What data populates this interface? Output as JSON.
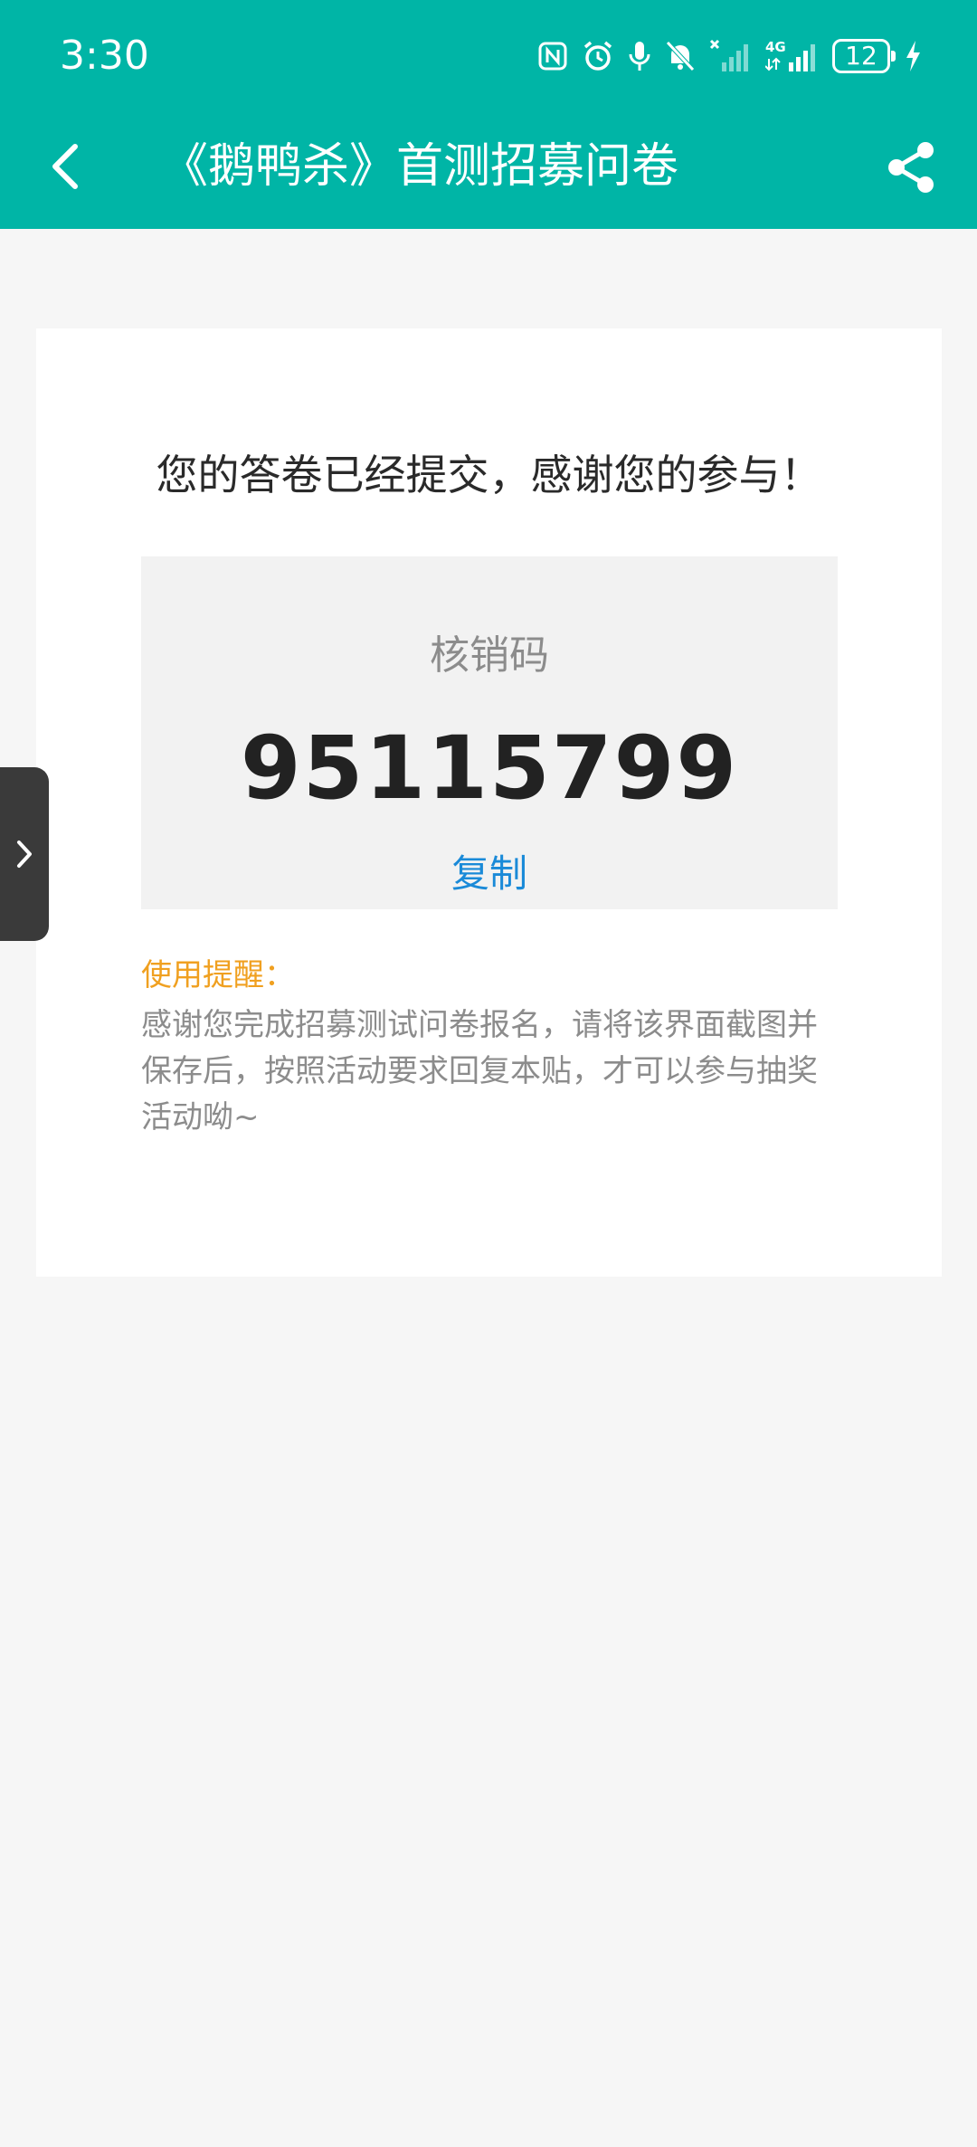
{
  "status_bar": {
    "time": "3:30",
    "battery_level": "12",
    "icons": [
      "nfc-icon",
      "alarm-icon",
      "mic-icon",
      "mute-bell-icon",
      "no-signal-icon",
      "4g-signal-icon",
      "battery-icon",
      "charging-icon"
    ]
  },
  "header": {
    "title": "《鹅鸭杀》首测招募问卷",
    "back_icon": "chevron-left-icon",
    "share_icon": "share-icon"
  },
  "result_card": {
    "headline": "您的答卷已经提交，感谢您的参与！",
    "code_label": "核销码",
    "code_value": "95115799",
    "copy_label": "复制",
    "tip_title": "使用提醒：",
    "tip_body": "感谢您完成招募测试问卷报名，请将该界面截图并保存后，按照活动要求回复本贴，才可以参与抽奖活动呦~"
  },
  "side_tab": {
    "icon": "chevron-right-icon"
  },
  "colors": {
    "header_bg": "#00b5a6",
    "page_bg": "#f6f6f6",
    "link": "#1a8ad8",
    "tip_title": "#f0a020"
  }
}
